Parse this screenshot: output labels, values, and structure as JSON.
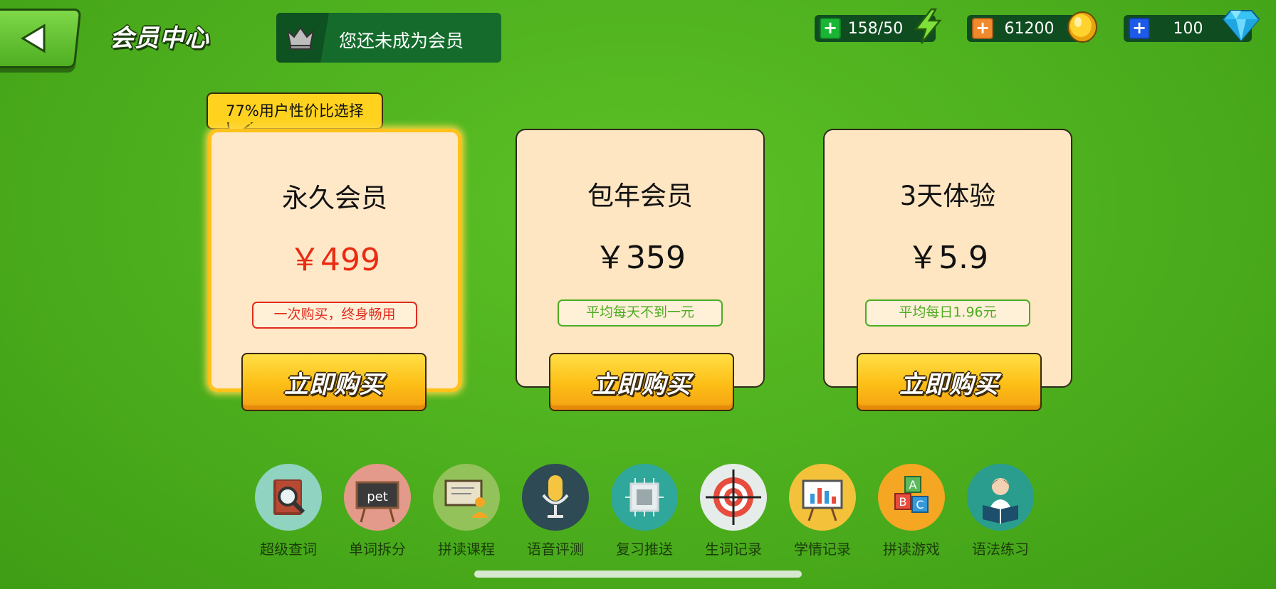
{
  "header": {
    "title": "会员中心",
    "member_status": "您还未成为会员"
  },
  "resources": [
    {
      "name": "energy",
      "value": "158/50",
      "plus_color": "#19b635",
      "icon": "lightning-icon"
    },
    {
      "name": "coins",
      "value": "61200",
      "plus_color": "#f08a2a",
      "icon": "coin-icon"
    },
    {
      "name": "diamonds",
      "value": "100",
      "plus_color": "#1e5ae8",
      "icon": "diamond-icon"
    }
  ],
  "badge": "77%用户性价比选择",
  "plans": [
    {
      "name": "永久会员",
      "price": "￥499",
      "tag": "一次购买，终身畅用",
      "button": "立即购买"
    },
    {
      "name": "包年会员",
      "price": "￥359",
      "tag": "平均每天不到一元",
      "button": "立即购买"
    },
    {
      "name": "3天体验",
      "price": "￥5.9",
      "tag": "平均每日1.96元",
      "button": "立即购买"
    }
  ],
  "features": [
    {
      "label": "超级查词",
      "icon": "dictionary-search-icon",
      "bg": "#8fd3c0"
    },
    {
      "label": "单词拆分",
      "icon": "word-board-icon",
      "bg": "#e49a8a"
    },
    {
      "label": "拼读课程",
      "icon": "teacher-board-icon",
      "bg": "#93c25a"
    },
    {
      "label": "语音评测",
      "icon": "microphone-icon",
      "bg": "#2e4a55"
    },
    {
      "label": "复习推送",
      "icon": "chip-icon",
      "bg": "#2fa79a"
    },
    {
      "label": "生词记录",
      "icon": "target-icon",
      "bg": "#e6ece9"
    },
    {
      "label": "学情记录",
      "icon": "chart-board-icon",
      "bg": "#f3c23a"
    },
    {
      "label": "拼读游戏",
      "icon": "abc-blocks-icon",
      "bg": "#f5a623"
    },
    {
      "label": "语法练习",
      "icon": "reader-icon",
      "bg": "#2a9d8f"
    }
  ]
}
